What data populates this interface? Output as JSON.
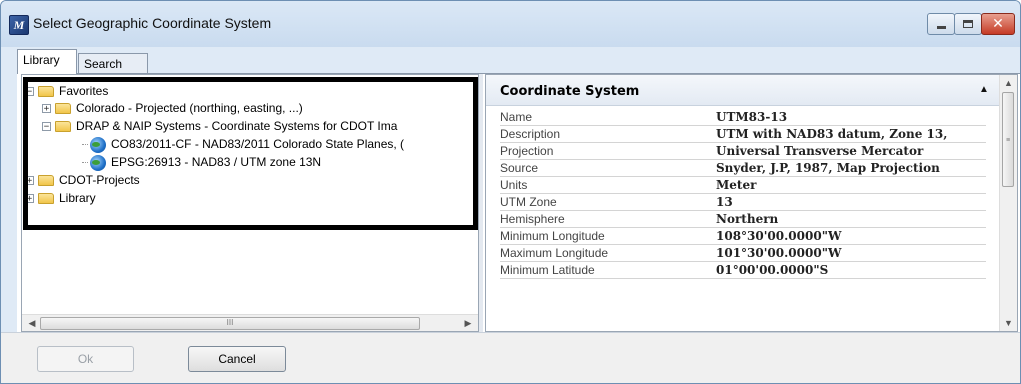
{
  "window": {
    "title": "Select Geographic Coordinate System",
    "icon": "app-logo-icon"
  },
  "tabs": [
    {
      "label": "Library",
      "active": true
    },
    {
      "label": "Search",
      "active": false
    }
  ],
  "tree": {
    "items": [
      {
        "label": "Favorites",
        "expander": "⊟",
        "icon": "folder-icon"
      },
      {
        "label": "Colorado - Projected (northing, easting, ...)",
        "expander": "⊞",
        "icon": "folder-icon"
      },
      {
        "label": "DRAP & NAIP Systems - Coordinate Systems for CDOT Ima",
        "expander": "⊟",
        "icon": "folder-icon"
      },
      {
        "label": "CO83/2011-CF - NAD83/2011 Colorado State Planes, (",
        "icon": "globe-icon"
      },
      {
        "label": "EPSG:26913 - NAD83 / UTM zone 13N",
        "icon": "globe-icon"
      },
      {
        "label": "CDOT-Projects",
        "expander": "⊞",
        "icon": "folder-icon"
      },
      {
        "label": "Library",
        "expander": "⊞",
        "icon": "folder-icon"
      }
    ],
    "scrollbar_thumb_glyph": "III"
  },
  "properties": {
    "header": "Coordinate System",
    "collapse_glyph": "▲",
    "rows": [
      {
        "label": "Name",
        "value": "UTM83-13"
      },
      {
        "label": "Description",
        "value": "UTM with NAD83 datum, Zone 13,"
      },
      {
        "label": "Projection",
        "value": "Universal Transverse Mercator"
      },
      {
        "label": "Source",
        "value": "Snyder, J.P, 1987, Map Projection"
      },
      {
        "label": "Units",
        "value": "Meter"
      },
      {
        "label": "UTM Zone",
        "value": "13"
      },
      {
        "label": "Hemisphere",
        "value": "Northern"
      },
      {
        "label": "Minimum Longitude",
        "value": "108°30'00.0000\"W"
      },
      {
        "label": "Maximum Longitude",
        "value": "101°30'00.0000\"W"
      },
      {
        "label": "Minimum Latitude",
        "value": "01°00'00.0000\"S"
      }
    ],
    "scrollbar_thumb_glyph": "≡"
  },
  "buttons": {
    "ok": "Ok",
    "cancel": "Cancel"
  }
}
